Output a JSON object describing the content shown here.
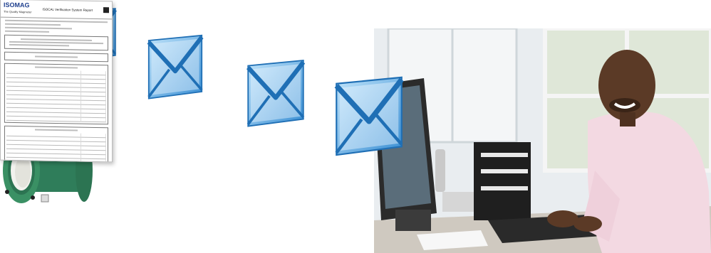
{
  "report": {
    "brand_name": "ISOMAG",
    "brand_tagline": "The Quality Magmeter",
    "title": "ISOCAL Verification System Report"
  },
  "icons": [
    "envelope-icon",
    "envelope-icon",
    "envelope-icon",
    "envelope-icon"
  ],
  "colors": {
    "envelope_front": "#7ec3ee",
    "envelope_dark": "#2b7fc7",
    "meter_green": "#2f7d5a",
    "pipe_liner": "#f2f2ee",
    "wall": "#e8ecef",
    "shirt": "#f3d9e2",
    "skin": "#5b3a26"
  }
}
